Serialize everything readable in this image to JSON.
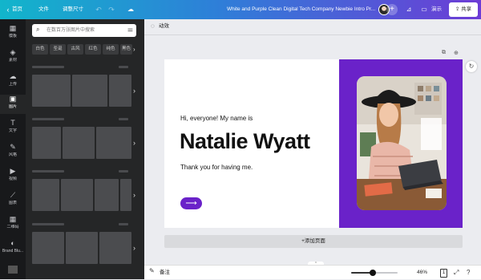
{
  "topbar": {
    "home": "首页",
    "file": "文件",
    "resize": "调整尺寸",
    "undo_icon": "undo-icon",
    "redo_icon": "redo-icon",
    "saved_icon": "cloud-icon",
    "title": "White and Purple Clean Digital Tech Company Newbie Intro Pr...",
    "present": "演示",
    "share": "共享",
    "plus": "+"
  },
  "rail": {
    "items": [
      {
        "label": "模板",
        "icon": "template-icon"
      },
      {
        "label": "素材",
        "icon": "elements-icon"
      },
      {
        "label": "上传",
        "icon": "upload-icon"
      },
      {
        "label": "图片",
        "icon": "photos-icon"
      },
      {
        "label": "文字",
        "icon": "text-icon"
      },
      {
        "label": "风格",
        "icon": "styles-icon"
      },
      {
        "label": "视频",
        "icon": "video-icon"
      },
      {
        "label": "图表",
        "icon": "charts-icon"
      },
      {
        "label": "二维码",
        "icon": "qrcode-icon"
      },
      {
        "label": "Brand Blu...",
        "icon": "brand-icon"
      }
    ],
    "active_index": 3
  },
  "panel": {
    "search_placeholder": "在数百万张图片中搜索",
    "chips": [
      "白色",
      "圣诞",
      "古风",
      "红色",
      "纯色",
      "黑色"
    ]
  },
  "main": {
    "animate": "动效",
    "add_page": "+添加页面"
  },
  "slide": {
    "greeting": "Hi, everyone! My name is",
    "name": "Natalie Wyatt",
    "thanks": "Thank you for having me.",
    "arrow": "⟶",
    "accent": "#6a22c9"
  },
  "bottombar": {
    "notes": "备注",
    "zoom": "46%",
    "zoom_fraction": 0.46,
    "page": "1"
  },
  "colors": {
    "topbar_gradient_start": "#12b5cb",
    "topbar_gradient_end": "#6d3cd6",
    "sidebar_bg": "#18191b",
    "panel_bg": "#252627",
    "canvas_bg": "#ebecf0"
  }
}
